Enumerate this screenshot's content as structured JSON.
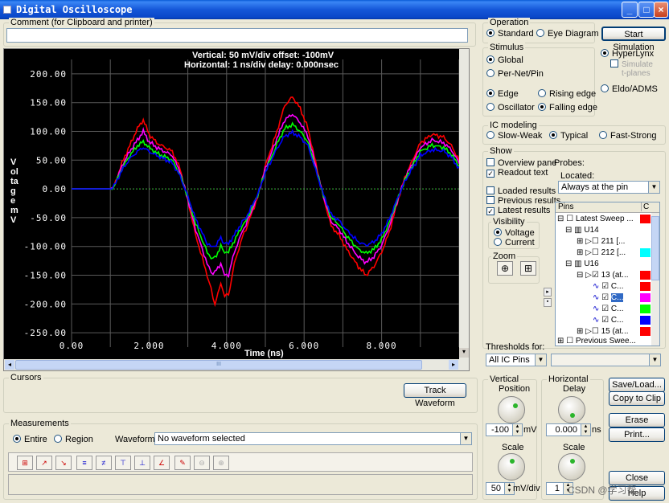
{
  "window": {
    "title": "Digital Oscilloscope"
  },
  "comment": {
    "label": "Comment (for Clipboard and printer)",
    "value": ""
  },
  "scope": {
    "header_line1": "Vertical: 50 mV/div  offset: -100mV",
    "header_line2": "Horizontal: 1 ns/div  delay: 0.000nsec",
    "y_label": "Voltage mV",
    "x_label": "Time  (ns)",
    "y_ticks": [
      "200.00",
      "150.00",
      "100.00",
      "50.00",
      "0.00",
      "-50.00",
      "-100.00",
      "-150.00",
      "-200.00",
      "-250.00"
    ],
    "x_ticks": [
      "0.00",
      "2.000",
      "4.000",
      "6.000",
      "8.000"
    ],
    "hscroll_grip": "III"
  },
  "chart_data": {
    "type": "line",
    "title": "",
    "xlabel": "Time  (ns)",
    "ylabel": "Voltage mV",
    "xlim": [
      0,
      10
    ],
    "ylim": [
      -275,
      225
    ],
    "grid": true,
    "series": [
      {
        "color": "#FF0000",
        "x": [
          0,
          1,
          1.1,
          1.3,
          1.5,
          1.7,
          1.85,
          2.0,
          2.2,
          2.6,
          2.8,
          3.0,
          3.2,
          3.5,
          3.6,
          3.7,
          3.85,
          3.95,
          4.05,
          4.2,
          4.4,
          4.5,
          4.8,
          5.0,
          5.3,
          5.5,
          5.7,
          5.9,
          6.1,
          6.3,
          6.5,
          6.7,
          6.9,
          7.1,
          7.4,
          7.6,
          7.8,
          8.0,
          8.2,
          8.4,
          8.6,
          8.8,
          9.0,
          9.3,
          9.6,
          9.8,
          10
        ],
        "values": [
          0,
          0,
          5,
          45,
          75,
          105,
          120,
          95,
          80,
          65,
          35,
          -20,
          -80,
          -150,
          -175,
          -200,
          -165,
          -185,
          -185,
          -130,
          -85,
          -70,
          -15,
          40,
          100,
          145,
          160,
          140,
          105,
          45,
          -15,
          -65,
          -80,
          -105,
          -135,
          -150,
          -135,
          -110,
          -75,
          -25,
          20,
          50,
          80,
          95,
          90,
          75,
          50
        ]
      },
      {
        "color": "#FF00FF",
        "x": [
          0,
          1,
          1.1,
          1.3,
          1.5,
          1.7,
          1.85,
          2.0,
          2.2,
          2.6,
          2.8,
          3.0,
          3.2,
          3.5,
          3.6,
          3.7,
          3.85,
          3.95,
          4.05,
          4.2,
          4.4,
          4.5,
          4.8,
          5.0,
          5.3,
          5.5,
          5.7,
          5.9,
          6.1,
          6.3,
          6.5,
          6.7,
          6.9,
          7.1,
          7.4,
          7.6,
          7.8,
          8.0,
          8.2,
          8.4,
          8.6,
          8.8,
          9.0,
          9.3,
          9.6,
          9.8,
          10
        ],
        "values": [
          0,
          0,
          5,
          40,
          65,
          85,
          100,
          82,
          72,
          58,
          30,
          -18,
          -70,
          -130,
          -145,
          -145,
          -130,
          -150,
          -150,
          -110,
          -75,
          -62,
          -13,
          35,
          88,
          120,
          130,
          115,
          92,
          40,
          -13,
          -57,
          -70,
          -92,
          -118,
          -128,
          -118,
          -98,
          -65,
          -22,
          18,
          45,
          72,
          85,
          80,
          68,
          45
        ]
      },
      {
        "color": "#00FF00",
        "x": [
          0,
          1,
          1.1,
          1.3,
          1.5,
          1.7,
          1.85,
          2.0,
          2.2,
          2.6,
          2.8,
          3.0,
          3.2,
          3.5,
          3.6,
          3.7,
          3.85,
          3.95,
          4.05,
          4.2,
          4.4,
          4.5,
          4.8,
          5.0,
          5.3,
          5.5,
          5.7,
          5.9,
          6.1,
          6.3,
          6.5,
          6.7,
          6.9,
          7.1,
          7.4,
          7.6,
          7.8,
          8.0,
          8.2,
          8.4,
          8.6,
          8.8,
          9.0,
          9.3,
          9.6,
          9.8,
          10
        ],
        "values": [
          0,
          0,
          5,
          35,
          58,
          75,
          82,
          72,
          62,
          50,
          25,
          -15,
          -60,
          -110,
          -120,
          -120,
          -100,
          -110,
          -110,
          -90,
          -65,
          -55,
          -11,
          30,
          78,
          105,
          112,
          100,
          82,
          35,
          -11,
          -50,
          -62,
          -82,
          -105,
          -112,
          -105,
          -88,
          -58,
          -20,
          15,
          40,
          65,
          76,
          72,
          60,
          40
        ]
      },
      {
        "color": "#0000FF",
        "x": [
          0,
          1,
          1.1,
          1.3,
          1.5,
          1.7,
          1.85,
          2.0,
          2.2,
          2.6,
          2.8,
          3.0,
          3.2,
          3.5,
          3.6,
          3.7,
          3.85,
          3.95,
          4.05,
          4.2,
          4.4,
          4.5,
          4.8,
          5.0,
          5.3,
          5.5,
          5.7,
          5.9,
          6.1,
          6.3,
          6.5,
          6.7,
          6.9,
          7.1,
          7.4,
          7.6,
          7.8,
          8.0,
          8.2,
          8.4,
          8.6,
          8.8,
          9.0,
          9.3,
          9.6,
          9.8,
          10
        ],
        "values": [
          0,
          0,
          5,
          32,
          52,
          65,
          72,
          65,
          58,
          45,
          22,
          -13,
          -52,
          -95,
          -100,
          -100,
          -85,
          -95,
          -95,
          -80,
          -58,
          -50,
          -10,
          28,
          70,
          92,
          98,
          90,
          75,
          32,
          -10,
          -45,
          -55,
          -72,
          -92,
          -98,
          -92,
          -78,
          -52,
          -18,
          13,
          36,
          58,
          68,
          66,
          55,
          35
        ]
      }
    ]
  },
  "operation": {
    "label": "Operation",
    "standard": "Standard",
    "eye": "Eye Diagram"
  },
  "start_button": "Start Simulation",
  "stimulus": {
    "label": "Stimulus",
    "global": "Global",
    "per_net": "Per-Net/Pin",
    "edge": "Edge",
    "oscillator": "Oscillator",
    "rising": "Rising edge",
    "falling": "Falling edge"
  },
  "simulator": {
    "hyperlynx": "HyperLynx",
    "simulate_tplanes_1": "Simulate",
    "simulate_tplanes_2": "t-planes",
    "eldo": "Eldo/ADMS"
  },
  "ic_modeling": {
    "label": "IC modeling",
    "slow": "Slow-Weak",
    "typical": "Typical",
    "fast": "Fast-Strong"
  },
  "show": {
    "label": "Show",
    "overview": "Overview pane",
    "readout": "Readout text",
    "loaded": "Loaded results",
    "previous": "Previous results",
    "latest": "Latest results",
    "probes": "Probes:",
    "located": "Located:",
    "located_value": "Always at the pin"
  },
  "visibility": {
    "label": "Visibility",
    "voltage": "Voltage",
    "current": "Current"
  },
  "zoom": {
    "label": "Zoom"
  },
  "pins_table": {
    "col_pins": "Pins",
    "col_c": "C",
    "rows": [
      {
        "text": "Latest Sweep ..."
      },
      {
        "text": "U14"
      },
      {
        "text": "211 [..."
      },
      {
        "text": "212 [..."
      },
      {
        "text": "U16"
      },
      {
        "text": "13 (at..."
      },
      {
        "text": "C..."
      },
      {
        "text": "C..."
      },
      {
        "text": "C..."
      },
      {
        "text": "C..."
      },
      {
        "text": "15 (at..."
      },
      {
        "text": "Previous Swee..."
      }
    ],
    "swatches": [
      "#FF0000",
      "#00FFFF",
      "#FF0000",
      "#FF0000",
      "#FF00FF",
      "#00FF00",
      "#0000FF",
      "#FF0000"
    ]
  },
  "thresholds": {
    "label": "Thresholds for:",
    "value": "All IC Pins"
  },
  "cursors": {
    "label": "Cursors",
    "track": "Track Waveform"
  },
  "measurements": {
    "label": "Measurements",
    "entire": "Entire",
    "region": "Region",
    "waveform_label": "Waveform:",
    "waveform_value": "No waveform selected"
  },
  "vertical": {
    "label": "Vertical",
    "position": "Position",
    "position_value": "-100",
    "position_unit": "mV",
    "scale": "Scale",
    "scale_value": "50",
    "scale_unit": "mV/div"
  },
  "horizontal": {
    "label": "Horizontal",
    "delay": "Delay",
    "delay_value": "0.000",
    "delay_unit": "ns",
    "scale": "Scale",
    "scale_value": "1"
  },
  "buttons": {
    "save_load": "Save/Load...",
    "copy_clip": "Copy to Clip",
    "erase": "Erase",
    "print": "Print...",
    "close": "Close",
    "help": "Help"
  },
  "watermark": "CSDN @学习帮"
}
